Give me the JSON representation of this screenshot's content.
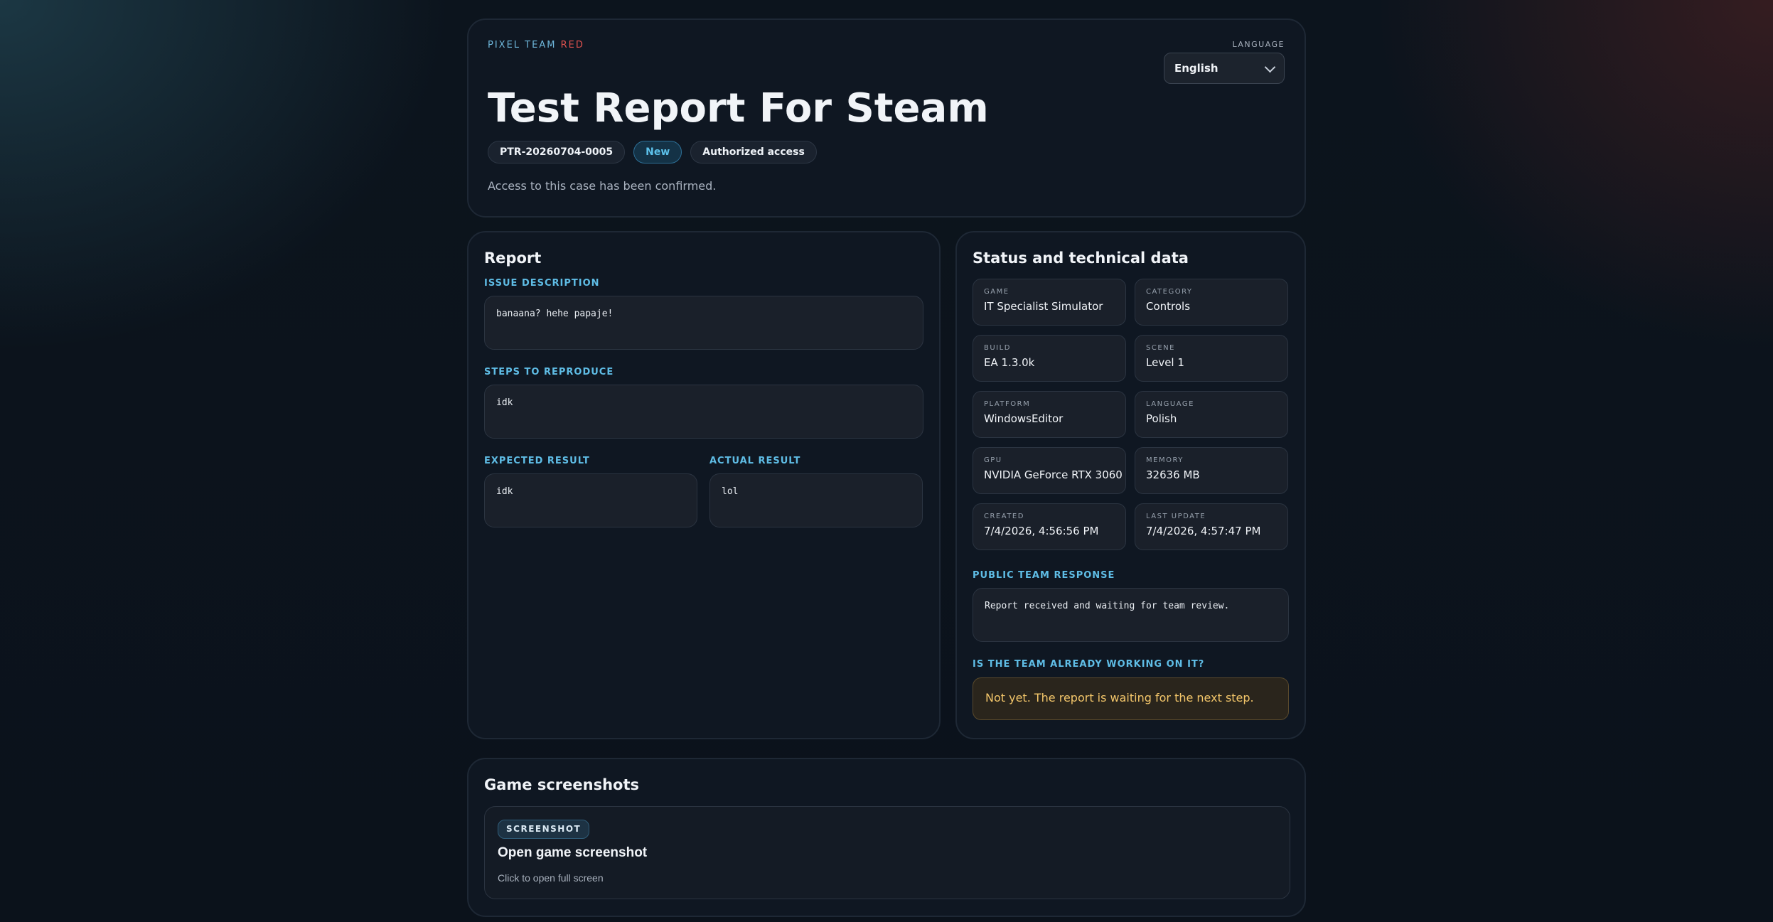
{
  "header": {
    "brand_prefix": "PIXEL TEAM",
    "brand_suffix": "RED",
    "title": "Test Report For Steam",
    "chips": [
      "PTR-20260704-0005",
      "New",
      "Authorized access"
    ],
    "subtext": "Access to this case has been confirmed.",
    "language_label": "LANGUAGE",
    "language_value": "English"
  },
  "report": {
    "heading": "Report",
    "issue_label": "ISSUE DESCRIPTION",
    "issue_value": "banaana? hehe papaje!",
    "steps_label": "STEPS TO REPRODUCE",
    "steps_value": "idk",
    "expected_label": "EXPECTED RESULT",
    "expected_value": "idk",
    "actual_label": "ACTUAL RESULT",
    "actual_value": "lol"
  },
  "status": {
    "heading": "Status and technical data",
    "fields": [
      {
        "label": "GAME",
        "value": "IT Specialist Simulator"
      },
      {
        "label": "CATEGORY",
        "value": "Controls"
      },
      {
        "label": "BUILD",
        "value": "EA 1.3.0k"
      },
      {
        "label": "SCENE",
        "value": "Level 1"
      },
      {
        "label": "PLATFORM",
        "value": "WindowsEditor"
      },
      {
        "label": "LANGUAGE",
        "value": "Polish"
      },
      {
        "label": "GPU",
        "value": "NVIDIA GeForce RTX 3060"
      },
      {
        "label": "MEMORY",
        "value": "32636 MB"
      },
      {
        "label": "CREATED",
        "value": "7/4/2026, 4:56:56 PM"
      },
      {
        "label": "LAST UPDATE",
        "value": "7/4/2026, 4:57:47 PM"
      }
    ],
    "response_label": "PUBLIC TEAM RESPONSE",
    "response_value": "Report received and waiting for team review.",
    "working_label": "IS THE TEAM ALREADY WORKING ON IT?",
    "working_value": "Not yet. The report is waiting for the next step."
  },
  "screenshots": {
    "heading": "Game screenshots",
    "badge": "SCREENSHOT",
    "title": "Open game screenshot",
    "subtitle": "Click to open full screen"
  }
}
